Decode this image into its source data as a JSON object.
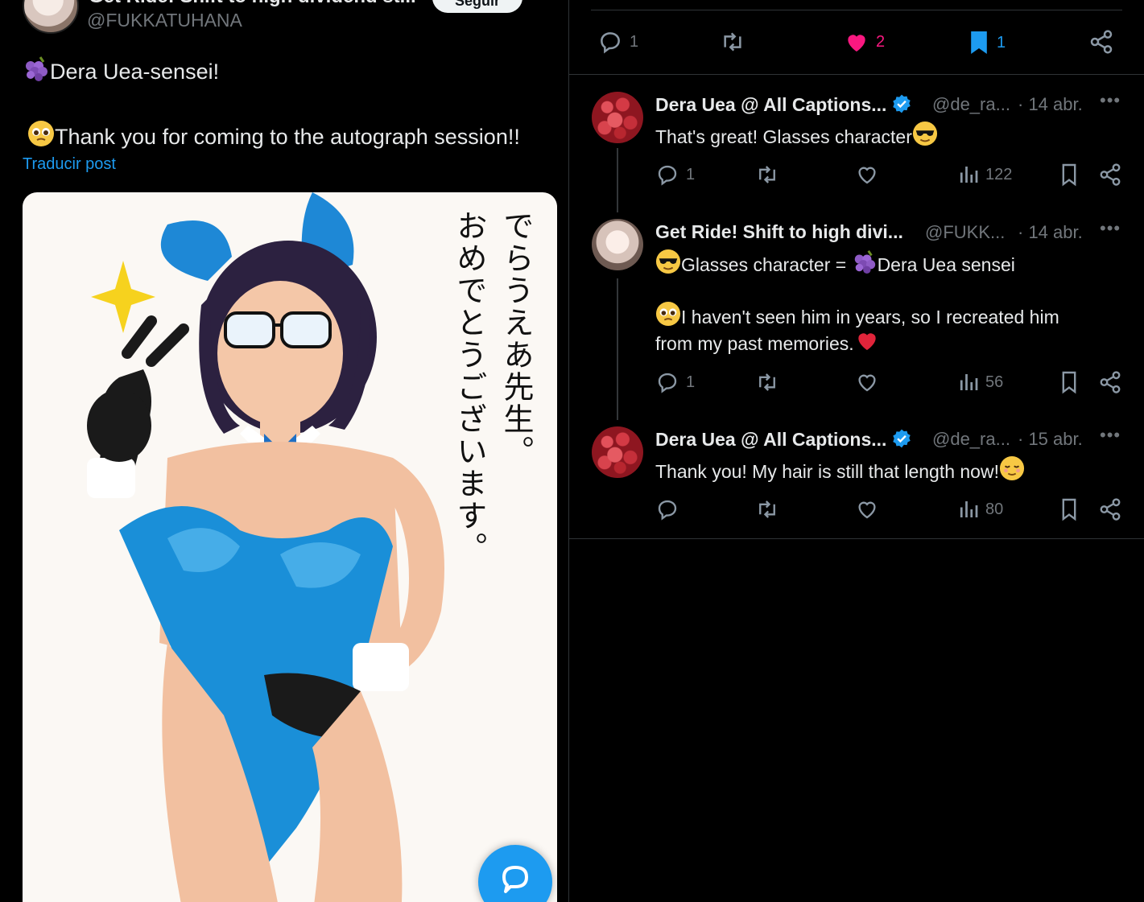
{
  "post": {
    "author_name": "Get Ride! Shift to high dividend st...",
    "author_handle": "@FUKKATUHANA",
    "follow_label": "Seguir",
    "line1": "Dera Uea-sensei!",
    "line2": "Thank you for coming to the autograph session!!",
    "translate_label": "Traducir post",
    "image_text_col1": "でらうえあ先生。",
    "image_text_col2": "おめでとうございます。"
  },
  "main_actions": {
    "reply_count": "1",
    "retweet_count": "",
    "like_count": "2",
    "bookmark_count": "1"
  },
  "replies": [
    {
      "name": "Dera Uea @ All Captions...",
      "handle": "@de_ra...",
      "date": "· 14 abr.",
      "text_lines": [
        "That's great! Glasses character"
      ],
      "reply_count": "1",
      "views": "122"
    },
    {
      "name": "Get Ride! Shift to high divi...",
      "handle": "@FUKK...",
      "date": "· 14 abr.",
      "text_lines": [
        "Glasses character = ",
        "Dera Uea sensei",
        "I haven't seen him in years, so I recreated him",
        "from my past memories."
      ],
      "reply_count": "1",
      "views": "56"
    },
    {
      "name": "Dera Uea @ All Captions...",
      "handle": "@de_ra...",
      "date": "· 15 abr.",
      "text_lines": [
        "Thank you! My hair is still that length now!"
      ],
      "reply_count": "",
      "views": "80"
    }
  ],
  "colors": {
    "accent_blue": "#1d9bf0",
    "like_pink": "#f91880",
    "muted": "#71767b",
    "separator": "#2f3336"
  },
  "icons": [
    "reply-icon",
    "retweet-icon",
    "like-icon",
    "bookmark-icon",
    "share-icon",
    "views-icon",
    "verified-icon",
    "more-icon"
  ]
}
